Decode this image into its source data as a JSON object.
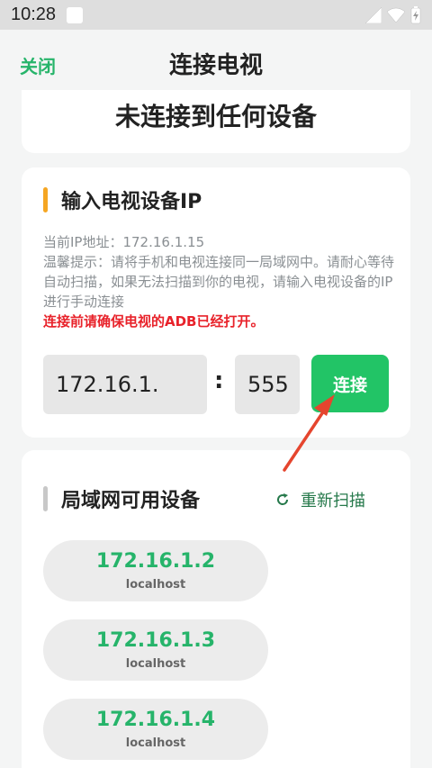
{
  "status_bar": {
    "time": "10:28"
  },
  "header": {
    "close_label": "关闭",
    "title": "连接电视"
  },
  "connection": {
    "status": "未连接到任何设备"
  },
  "ip_section": {
    "title": "输入电视设备IP",
    "current_ip_label": "当前IP地址：172.16.1.15",
    "hint": "温馨提示：请将手机和电视连接同一局域网中。请耐心等待自动扫描，如果无法扫描到你的电视，请输入电视设备的IP进行手动连接",
    "warning": "连接前请确保电视的ADB已经打开。",
    "ip_value": "172.16.1.",
    "separator": ":",
    "port_value": "555",
    "connect_label": "连接",
    "accent_color": "#f5a623"
  },
  "lan_section": {
    "title": "局域网可用设备",
    "rescan_label": "重新扫描",
    "devices": [
      {
        "ip": "172.16.1.2",
        "host": "localhost"
      },
      {
        "ip": "172.16.1.3",
        "host": "localhost"
      },
      {
        "ip": "172.16.1.4",
        "host": "localhost"
      }
    ]
  },
  "colors": {
    "brand_green": "#22c466",
    "warning_red": "#e8222a",
    "arrow_red": "#e5452e"
  }
}
